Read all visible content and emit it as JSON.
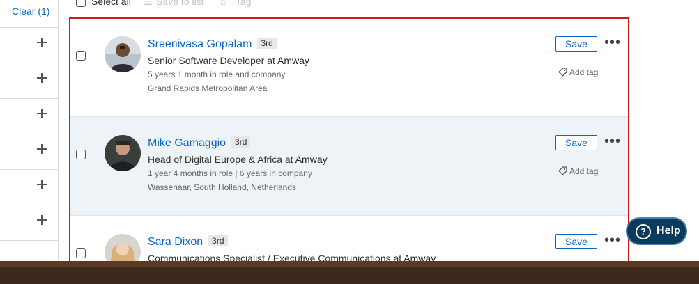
{
  "filters": {
    "clear_label": "Clear (1)",
    "rows": 6
  },
  "toolbar": {
    "select_all": "Select all",
    "save_to_list": "Save to list",
    "tag": "Tag"
  },
  "results": [
    {
      "name": "Sreenivasa Gopalam",
      "degree": "3rd",
      "role": "Senior Software Developer",
      "at": "at",
      "company": "Amway",
      "tenure": "5 years 1 month in role and company",
      "location": "Grand Rapids Metropolitan Area",
      "save": "Save",
      "add_tag": "Add tag"
    },
    {
      "name": "Mike Gamaggio",
      "degree": "3rd",
      "role": "Head of Digital Europe & Africa",
      "at": "at",
      "company": "Amway",
      "tenure": "1 year 4 months in role  | 6 years in company",
      "location": "Wassenaar, South Holland, Netherlands",
      "save": "Save",
      "add_tag": "Add tag"
    },
    {
      "name": "Sara Dixon",
      "degree": "3rd",
      "role": "Communications Specialist / Executive Communications",
      "at": "at",
      "company": "Amway",
      "save": "Save"
    }
  ],
  "help": {
    "label": "Help"
  },
  "icons": {
    "more": "more-icon",
    "tag": "tag-icon",
    "help": "help-icon"
  },
  "colors": {
    "link": "#0a66c2",
    "frame": "#d11a1a",
    "help_bg": "#0a3a5c"
  }
}
